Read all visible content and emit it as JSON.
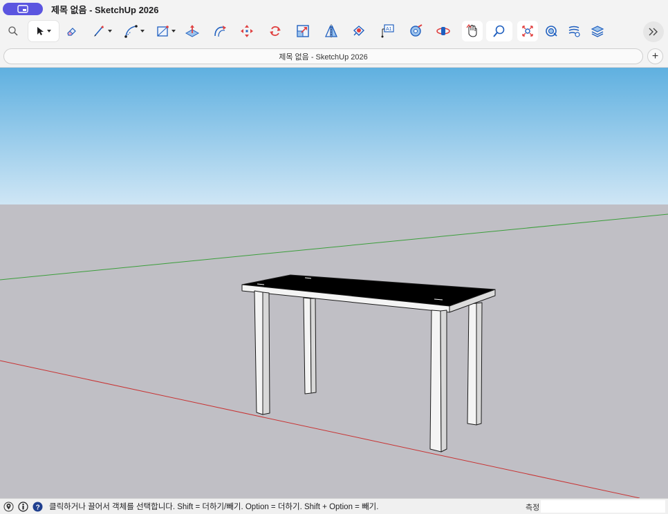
{
  "window": {
    "title": "제목 없음 - SketchUp 2026"
  },
  "tab": {
    "label": "제목 없음 - SketchUp 2026",
    "new_tab_label": "+"
  },
  "toolbar": {
    "tools": [
      {
        "name": "search-tool",
        "icon": "magnifier-icon"
      },
      {
        "name": "select-tool",
        "icon": "arrow-cursor-icon",
        "active": true,
        "has_menu": true
      },
      {
        "name": "eraser-tool",
        "icon": "eraser-icon"
      },
      {
        "name": "pencil-tool",
        "icon": "pencil-icon",
        "has_menu": true
      },
      {
        "name": "arc-tool",
        "icon": "arc-icon",
        "has_menu": true
      },
      {
        "name": "shape-tool",
        "icon": "rectangle-icon",
        "has_menu": true
      },
      {
        "name": "push-pull-tool",
        "icon": "push-pull-icon"
      },
      {
        "name": "follow-me-tool",
        "icon": "follow-me-icon"
      },
      {
        "name": "move-tool",
        "icon": "move-arrows-icon"
      },
      {
        "name": "rotate-tool",
        "icon": "rotate-icon"
      },
      {
        "name": "scale-tool",
        "icon": "scale-icon"
      },
      {
        "name": "flip-tool",
        "icon": "flip-icon"
      },
      {
        "name": "paint-bucket-tool",
        "icon": "paint-icon"
      },
      {
        "name": "text-tool",
        "icon": "text-label-icon"
      },
      {
        "name": "tape-measure-tool",
        "icon": "tape-measure-icon"
      },
      {
        "name": "orbit-tool",
        "icon": "orbit-icon"
      },
      {
        "name": "pan-tool",
        "icon": "hand-icon"
      },
      {
        "name": "zoom-tool",
        "icon": "zoom-icon"
      },
      {
        "name": "zoom-extents-tool",
        "icon": "zoom-extents-icon"
      },
      {
        "name": "components-tool",
        "icon": "components-icon"
      },
      {
        "name": "styles-tool",
        "icon": "styles-icon"
      },
      {
        "name": "tags-tool",
        "icon": "layers-icon"
      }
    ],
    "more_icon": "double-chevron-right-icon"
  },
  "statusbar": {
    "icons": [
      "geolocation-icon",
      "credits-icon",
      "help-icon"
    ],
    "hint": "클릭하거나 끌어서 객체를 선택합니다. Shift = 더하기/빼기. Option = 더하기. Shift + Option = 빼기.",
    "measure_label": "측정",
    "measure_value": ""
  },
  "colors": {
    "accent": "#5b55e0",
    "sky_top": "#5fb0e0",
    "sky_bottom": "#cfe6f5",
    "ground": "#c0bfc5",
    "green_axis": "#3a9e3a",
    "red_axis": "#c83232"
  }
}
